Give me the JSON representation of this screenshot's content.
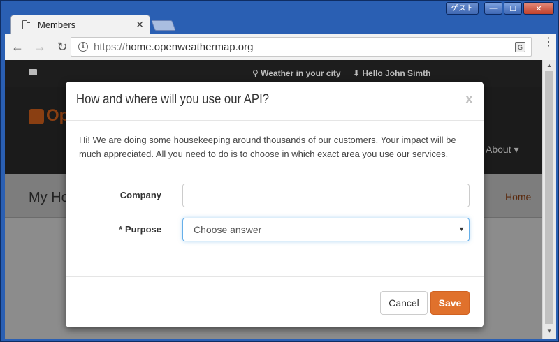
{
  "window": {
    "guest_label": "ゲスト",
    "minimize": "—",
    "maximize": "☐",
    "close": "✕"
  },
  "tab": {
    "title": "Members",
    "close": "✕"
  },
  "toolbar": {
    "back": "←",
    "forward": "→",
    "reload": "↻",
    "url_scheme": "https://",
    "url_host": "home.openweathermap.org",
    "translate": "G",
    "menu": "⋮"
  },
  "site": {
    "weather_link": "Weather in your city",
    "hello": "Hello John Simth",
    "logo_text": "Op",
    "about": "About ▾",
    "page_heading": "My Ho",
    "home_link": "Home"
  },
  "modal": {
    "title": "How and where will you use our API?",
    "close": "x",
    "text": "Hi! We are doing some housekeeping around thousands of our customers. Your impact will be much appreciated. All you need to do is to choose in which exact area you use our services.",
    "company_label": "Company",
    "company_value": "",
    "purpose_required": "*",
    "purpose_label": "Purpose",
    "purpose_value": "Choose answer",
    "cancel": "Cancel",
    "save": "Save"
  }
}
